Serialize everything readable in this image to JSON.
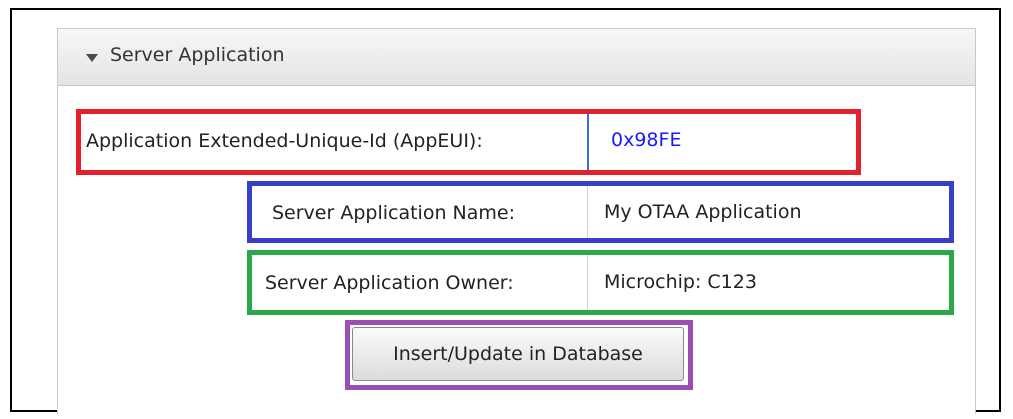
{
  "panel": {
    "title": "Server Application",
    "collapse_icon": "triangle-down-icon"
  },
  "fields": {
    "app_eui": {
      "label": "Application Extended-Unique-Id (AppEUI):",
      "value": "0x98FE",
      "value_color": "#1a1aff"
    },
    "app_name": {
      "label": "Server Application Name:",
      "value": "My OTAA Application"
    },
    "app_owner": {
      "label": "Server Application Owner:",
      "value": "Microchip: C123"
    }
  },
  "actions": {
    "insert_update_label": "Insert/Update in Database"
  },
  "highlight_colors": {
    "app_eui": "#e5202e",
    "app_name": "#3a3fc8",
    "app_owner": "#2aa84a",
    "button": "#9b4fb3"
  }
}
